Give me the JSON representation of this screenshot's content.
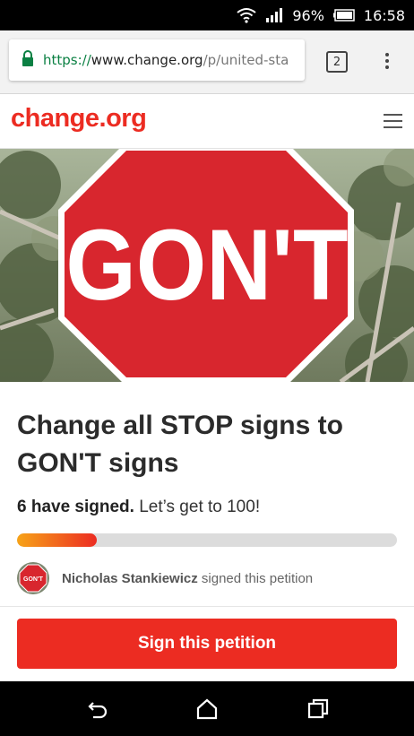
{
  "status_bar": {
    "battery": "96%",
    "time": "16:58"
  },
  "browser": {
    "url_scheme": "https://",
    "url_host": "www.change.org",
    "url_path": "/p/united-sta",
    "tab_count": "2"
  },
  "site": {
    "logo": "change.org",
    "brand_color": "#ec2c22"
  },
  "hero": {
    "sign_text": "GON'T",
    "sign_color": "#d8262e"
  },
  "petition": {
    "title": "Change all STOP signs to GON'T signs",
    "signed_count_text": "6 have signed.",
    "goal_text": "Let’s get to 100!",
    "progress": 0.21,
    "recent_signer": "Nicholas Stankiewicz",
    "recent_action": "signed this petition",
    "avatar_text": "GON'T"
  },
  "actions": {
    "sign_label": "Sign this petition"
  },
  "icons": {
    "lock": "lock-icon",
    "tabs": "tab-switcher-icon",
    "menu": "overflow-menu-icon",
    "hamburger": "hamburger-menu-icon",
    "back": "back-icon",
    "home": "home-icon",
    "recents": "recent-apps-icon"
  }
}
